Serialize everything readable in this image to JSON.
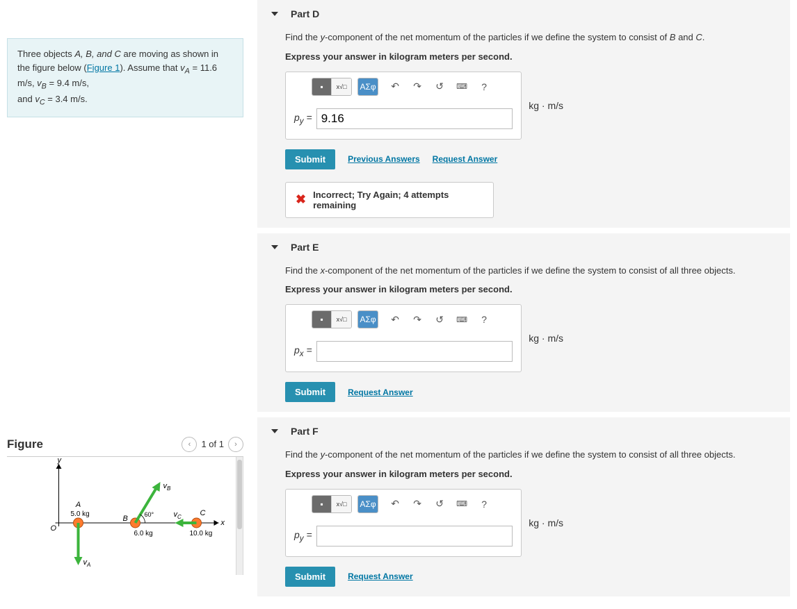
{
  "problem": {
    "text_prefix": "Three objects ",
    "objs": "A, B, and C",
    "text_mid": " are moving as shown in the figure below (",
    "figlink": "Figure 1",
    "text_after": "). Assume that ",
    "vA_label": "v_A",
    "vA_val": "= 11.6 m/s, ",
    "vB_label": "v_B",
    "vB_val": "= 9.4 m/s,",
    "and": "and ",
    "vC_label": "v_C",
    "vC_val": "= 3.4 m/s."
  },
  "figure": {
    "title": "Figure",
    "counter": "1 of 1",
    "labels": {
      "y": "y",
      "x": "x",
      "O": "O",
      "A": "A",
      "B": "B",
      "C": "C",
      "mA": "5.0 kg",
      "mB": "6.0 kg",
      "mC": "10.0 kg",
      "angle": "60°",
      "vA": "v_A",
      "vB": "v_B",
      "vC": "v_C"
    }
  },
  "parts": {
    "D": {
      "title": "Part D",
      "prompt": "Find the y-component of the net momentum of the particles if we define the system to consist of B and C.",
      "instr": "Express your answer in kilogram meters per second.",
      "lhs": "p_y =",
      "value": "9.16",
      "units": "kg · m/s",
      "submit": "Submit",
      "prev": "Previous Answers",
      "req": "Request Answer",
      "feedback": "Incorrect; Try Again; 4 attempts remaining"
    },
    "E": {
      "title": "Part E",
      "prompt": "Find the x-component of the net momentum of the particles if we define the system to consist of all three objects.",
      "instr": "Express your answer in kilogram meters per second.",
      "lhs": "p_x =",
      "value": "",
      "units": "kg · m/s",
      "submit": "Submit",
      "req": "Request Answer"
    },
    "F": {
      "title": "Part F",
      "prompt": "Find the y-component of the net momentum of the particles if we define the system to consist of all three objects.",
      "instr": "Express your answer in kilogram meters per second.",
      "lhs": "p_y =",
      "value": "",
      "units": "kg · m/s",
      "submit": "Submit",
      "req": "Request Answer"
    }
  },
  "toolbar": {
    "greek": "ΑΣφ"
  }
}
